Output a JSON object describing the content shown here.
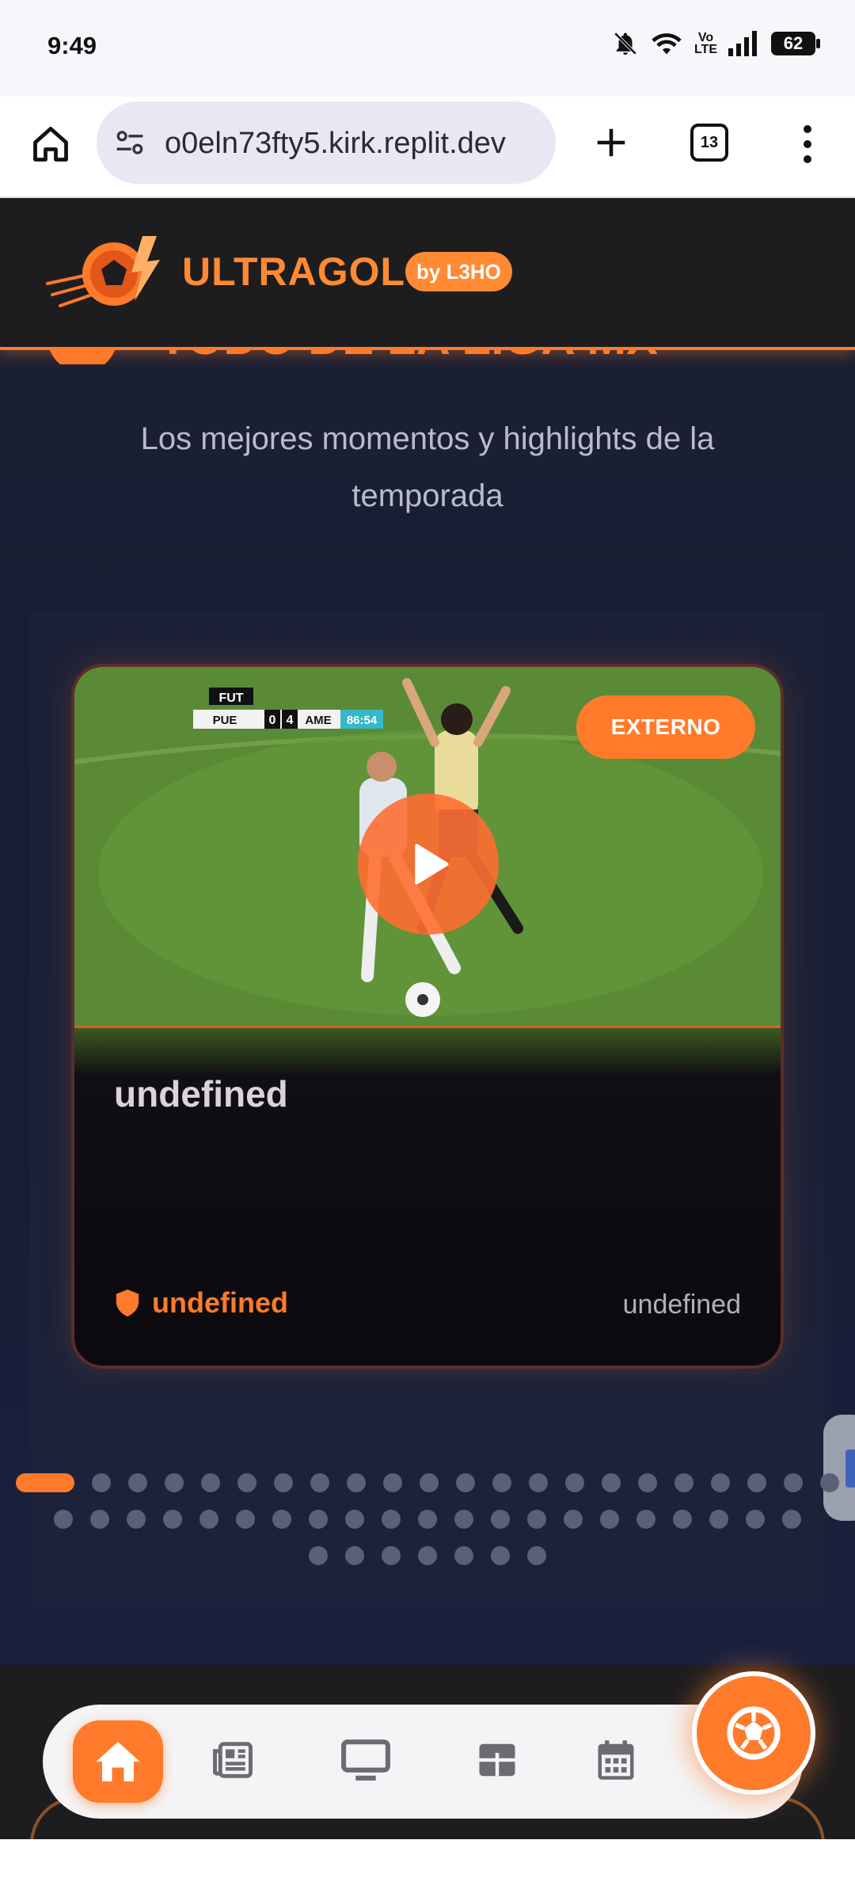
{
  "status_bar": {
    "time": "9:49",
    "volte_line1": "Vo",
    "volte_line2": "LTE",
    "battery": "62",
    "icons": [
      "bell-off-icon",
      "wifi-icon",
      "volte-icon",
      "signal-icon",
      "battery-icon"
    ]
  },
  "browser": {
    "url": "o0eln73fty5.kirk.replit.dev",
    "tab_count": "13",
    "icons": [
      "home-icon",
      "tune-icon",
      "plus-icon",
      "tabs-icon",
      "more-vert-icon"
    ]
  },
  "header": {
    "brand": "ULTRAGOL",
    "badge": "by L3HO"
  },
  "section": {
    "title": "TODO DE LA LIGA MX",
    "subtitle": "Los mejores momentos y highlights de la temporada"
  },
  "card": {
    "external_label": "EXTERNO",
    "title": "undefined",
    "team": "undefined",
    "date": "undefined",
    "scorebug": {
      "brand": "FUT",
      "home": "PUE",
      "home_score": "0",
      "away_score": "4",
      "away": "AME",
      "clock": "86:54"
    }
  },
  "carousel": {
    "total_slides": 51,
    "active_index": 0
  },
  "bottom_nav": {
    "items": [
      "home",
      "news",
      "tv",
      "tables",
      "calendar"
    ],
    "fab": "soccer-ball-icon"
  },
  "colors": {
    "accent": "#ff7a2a",
    "header_bg": "#1d1d1f",
    "page_bg": "#1a2038"
  }
}
